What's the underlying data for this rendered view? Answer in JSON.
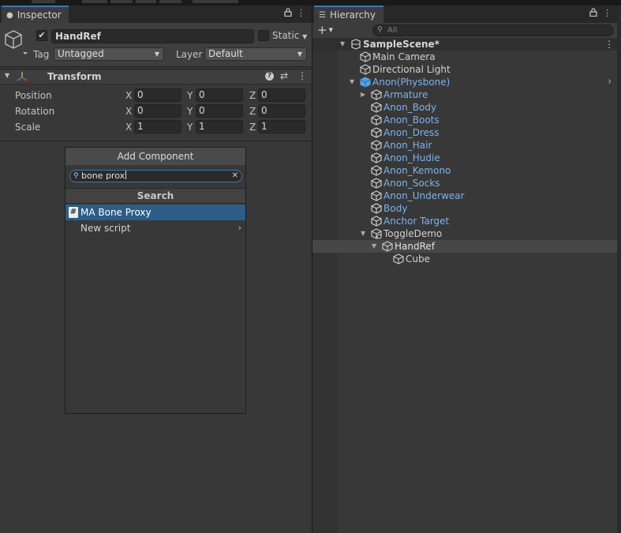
{
  "top_tabs": [
    {
      "w": 28
    },
    {
      "w": 10
    },
    {
      "w": 28
    },
    {
      "w": 28
    },
    {
      "w": 28
    }
  ],
  "inspector": {
    "tab_label": "Inspector",
    "object": {
      "active": true,
      "name": "HandRef",
      "static_label": "Static",
      "tag_label": "Tag",
      "tag_value": "Untagged",
      "layer_label": "Layer",
      "layer_value": "Default"
    },
    "transform": {
      "title": "Transform",
      "rows": [
        {
          "label": "Position",
          "x": "0",
          "y": "0",
          "z": "0"
        },
        {
          "label": "Rotation",
          "x": "0",
          "y": "0",
          "z": "0"
        },
        {
          "label": "Scale",
          "x": "1",
          "y": "1",
          "z": "1"
        }
      ],
      "axis_labels": {
        "x": "X",
        "y": "Y",
        "z": "Z"
      }
    },
    "add_component": {
      "title": "Add Component",
      "search_value": "bone prox",
      "section": "Search",
      "items": [
        {
          "label": "MA Bone Proxy",
          "selected": true,
          "icon": "script-hash-icon"
        },
        {
          "label": "New script",
          "selected": false,
          "submenu": true
        }
      ]
    }
  },
  "hierarchy": {
    "tab_label": "Hierarchy",
    "search_placeholder": "All",
    "items": [
      {
        "label": "SampleScene*",
        "type": "scene",
        "depth": 0,
        "expanded": true
      },
      {
        "label": "Main Camera",
        "type": "object",
        "depth": 1
      },
      {
        "label": "Directional Light",
        "type": "object",
        "depth": 1
      },
      {
        "label": "Anon(Physbone)",
        "type": "prefab-root",
        "depth": 1,
        "expanded": true,
        "has_arrow": true
      },
      {
        "label": "Armature",
        "type": "prefab",
        "depth": 2,
        "collapsed": true
      },
      {
        "label": "Anon_Body",
        "type": "prefab",
        "depth": 2
      },
      {
        "label": "Anon_Boots",
        "type": "prefab",
        "depth": 2
      },
      {
        "label": "Anon_Dress",
        "type": "prefab",
        "depth": 2
      },
      {
        "label": "Anon_Hair",
        "type": "prefab",
        "depth": 2
      },
      {
        "label": "Anon_Hudie",
        "type": "prefab",
        "depth": 2
      },
      {
        "label": "Anon_Kemono",
        "type": "prefab",
        "depth": 2
      },
      {
        "label": "Anon_Socks",
        "type": "prefab",
        "depth": 2
      },
      {
        "label": "Anon_Underwear",
        "type": "prefab",
        "depth": 2
      },
      {
        "label": "Body",
        "type": "prefab",
        "depth": 2
      },
      {
        "label": "Anchor Target",
        "type": "prefab",
        "depth": 2
      },
      {
        "label": "ToggleDemo",
        "type": "object-special",
        "depth": 2,
        "expanded": true
      },
      {
        "label": "HandRef",
        "type": "object",
        "depth": 3,
        "expanded": true,
        "selected": true
      },
      {
        "label": "Cube",
        "type": "object",
        "depth": 4
      }
    ]
  },
  "colors": {
    "accent": "#3a79bb",
    "selection": "#2c5d87",
    "prefab_text": "#7fb2ec"
  }
}
